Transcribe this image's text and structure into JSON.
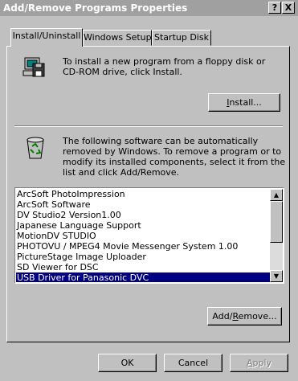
{
  "window": {
    "title": "Add/Remove Programs Properties"
  },
  "titlebar": {
    "help_label": "?",
    "close_label": "X"
  },
  "tabs": [
    {
      "label": "Install/Uninstall",
      "active": true
    },
    {
      "label": "Windows Setup",
      "active": false
    },
    {
      "label": "Startup Disk",
      "active": false
    }
  ],
  "install": {
    "icon": "floppy-computer-icon",
    "description": "To install a new program from a floppy disk or CD-ROM drive, click Install.",
    "button_label": "Install..."
  },
  "remove": {
    "icon": "recycle-bin-icon",
    "description": "The following software can be automatically removed by Windows. To remove a program or to modify its installed components, select it from the list and click Add/Remove.",
    "button_label": "Add/Remove..."
  },
  "programs": [
    {
      "label": "ArcSoft PhotoImpression",
      "selected": false
    },
    {
      "label": "ArcSoft Software",
      "selected": false
    },
    {
      "label": "DV Studio2 Version1.00",
      "selected": false
    },
    {
      "label": "Japanese Language Support",
      "selected": false
    },
    {
      "label": "MotionDV STUDIO",
      "selected": false
    },
    {
      "label": "PHOTOVU / MPEG4 Movie Messenger System 1.00",
      "selected": false
    },
    {
      "label": "PictureStage Image Uploader",
      "selected": false
    },
    {
      "label": "SD Viewer for DSC",
      "selected": false
    },
    {
      "label": "USB Driver for Panasonic DVC",
      "selected": true
    }
  ],
  "footer": {
    "ok_label": "OK",
    "cancel_label": "Cancel",
    "apply_label": "Apply",
    "apply_enabled": false
  }
}
